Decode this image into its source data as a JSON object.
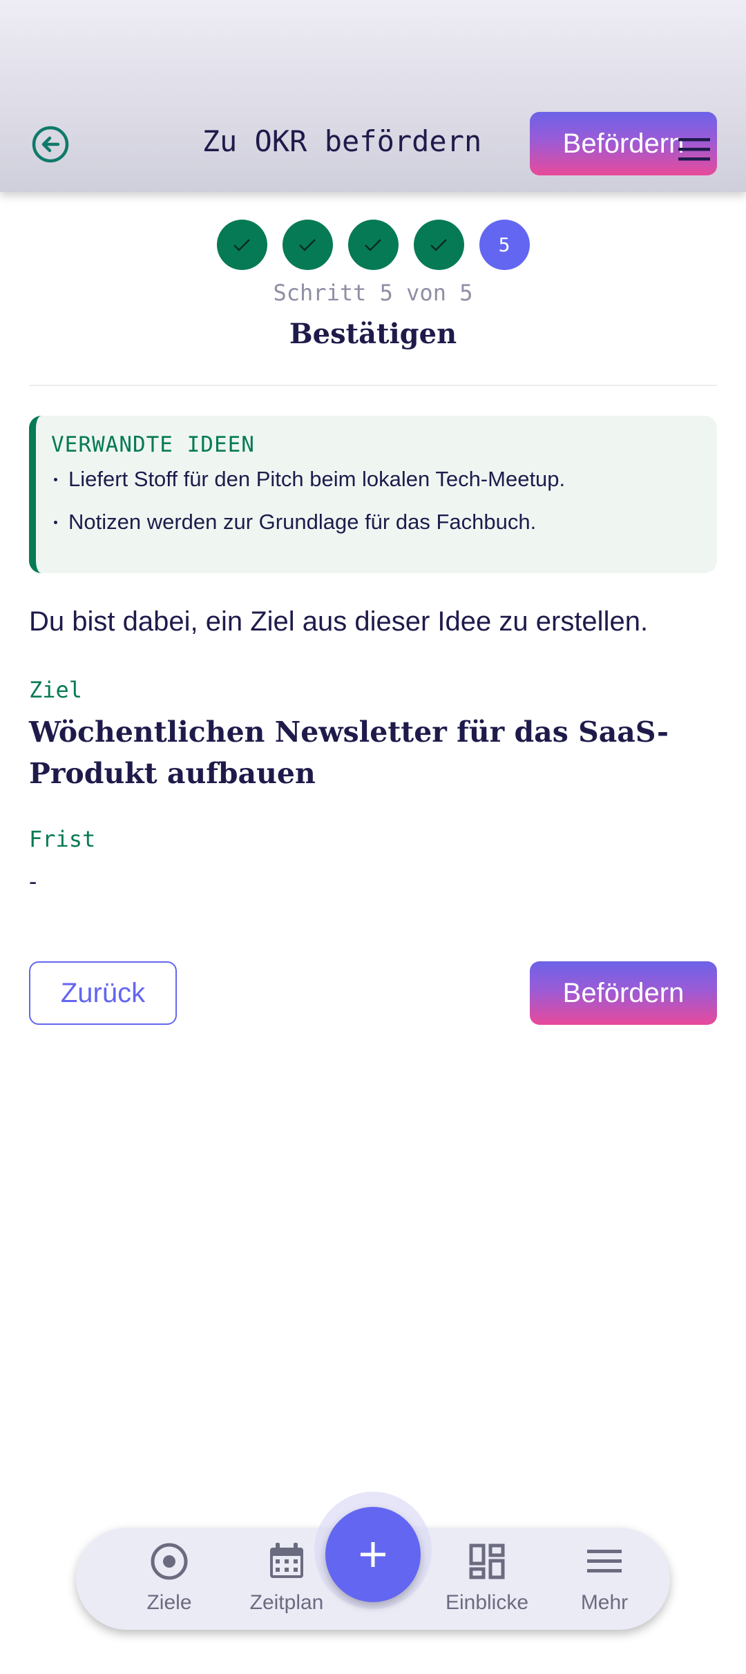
{
  "header": {
    "title": "Zu OKR befördern",
    "promote_label": "Befördern",
    "icons": {
      "back": "back-arrow-circle-icon",
      "menu": "hamburger-menu-icon"
    }
  },
  "stepper": {
    "steps": [
      "done",
      "done",
      "done",
      "done",
      "5"
    ],
    "current_label": "5",
    "count_text": "Schritt 5 von 5",
    "title": "Bestätigen"
  },
  "related": {
    "label": "VERWANDTE IDEEN",
    "items": [
      "Liefert Stoff für den Pitch beim lokalen Tech-Meetup.",
      "Notizen werden zur Grundlage für das Fachbuch."
    ]
  },
  "intro": "Du bist dabei, ein Ziel aus dieser Idee zu erstellen.",
  "goal": {
    "label": "Ziel",
    "value": "Wöchentlichen Newsletter für das SaaS-Produkt aufbauen"
  },
  "deadline": {
    "label": "Frist",
    "value": "-"
  },
  "actions": {
    "back_label": "Zurück",
    "promote_label": "Befördern"
  },
  "bottom_nav": {
    "items": [
      {
        "label": "Ziele",
        "icon": "target-icon"
      },
      {
        "label": "Zeitplan",
        "icon": "calendar-icon"
      },
      {
        "label": "Einblicke",
        "icon": "dashboard-icon"
      },
      {
        "label": "Mehr",
        "icon": "menu-icon"
      }
    ],
    "fab_icon": "plus-icon"
  },
  "colors": {
    "accent": "#6366f1",
    "success": "#067a55",
    "text": "#1e1b4b",
    "pink": "#e84a9a"
  }
}
